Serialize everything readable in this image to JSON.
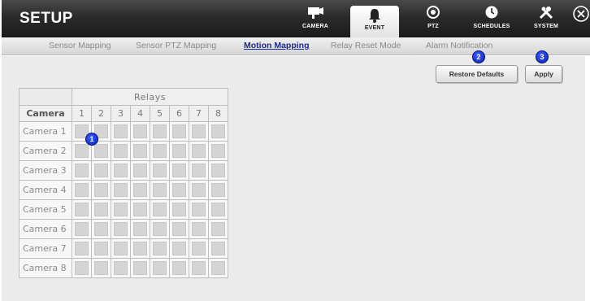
{
  "app": {
    "title": "SETUP"
  },
  "nav": [
    {
      "id": "camera",
      "label": "CAMERA",
      "icon": "camera-icon",
      "active": false
    },
    {
      "id": "event",
      "label": "EVENT",
      "icon": "bell-icon",
      "active": true
    },
    {
      "id": "ptz",
      "label": "PTZ",
      "icon": "ptz-icon",
      "active": false
    },
    {
      "id": "schedules",
      "label": "SCHEDULES",
      "icon": "clock-icon",
      "active": false
    },
    {
      "id": "system",
      "label": "SYSTEM",
      "icon": "tools-icon",
      "active": false
    }
  ],
  "subtabs": [
    {
      "label": "Sensor Mapping",
      "active": false
    },
    {
      "label": "Sensor PTZ Mapping",
      "active": false
    },
    {
      "label": "Motion Mapping",
      "active": true
    },
    {
      "label": "Relay Reset Mode",
      "active": false
    },
    {
      "label": "Alarm Notification",
      "active": false
    }
  ],
  "actions": {
    "restore_defaults": "Restore Defaults",
    "apply": "Apply"
  },
  "callouts": {
    "one": "1",
    "two": "2",
    "three": "3"
  },
  "grid": {
    "group_header": "Relays",
    "row_header": "Camera",
    "relays": [
      "1",
      "2",
      "3",
      "4",
      "5",
      "6",
      "7",
      "8"
    ],
    "cameras": [
      "Camera 1",
      "Camera 2",
      "Camera 3",
      "Camera 4",
      "Camera 5",
      "Camera 6",
      "Camera 7",
      "Camera 8"
    ]
  },
  "colors": {
    "topbar": "#2b2b2b",
    "active_subtab": "#1a2a8c",
    "badge": "#0a1fb8"
  }
}
